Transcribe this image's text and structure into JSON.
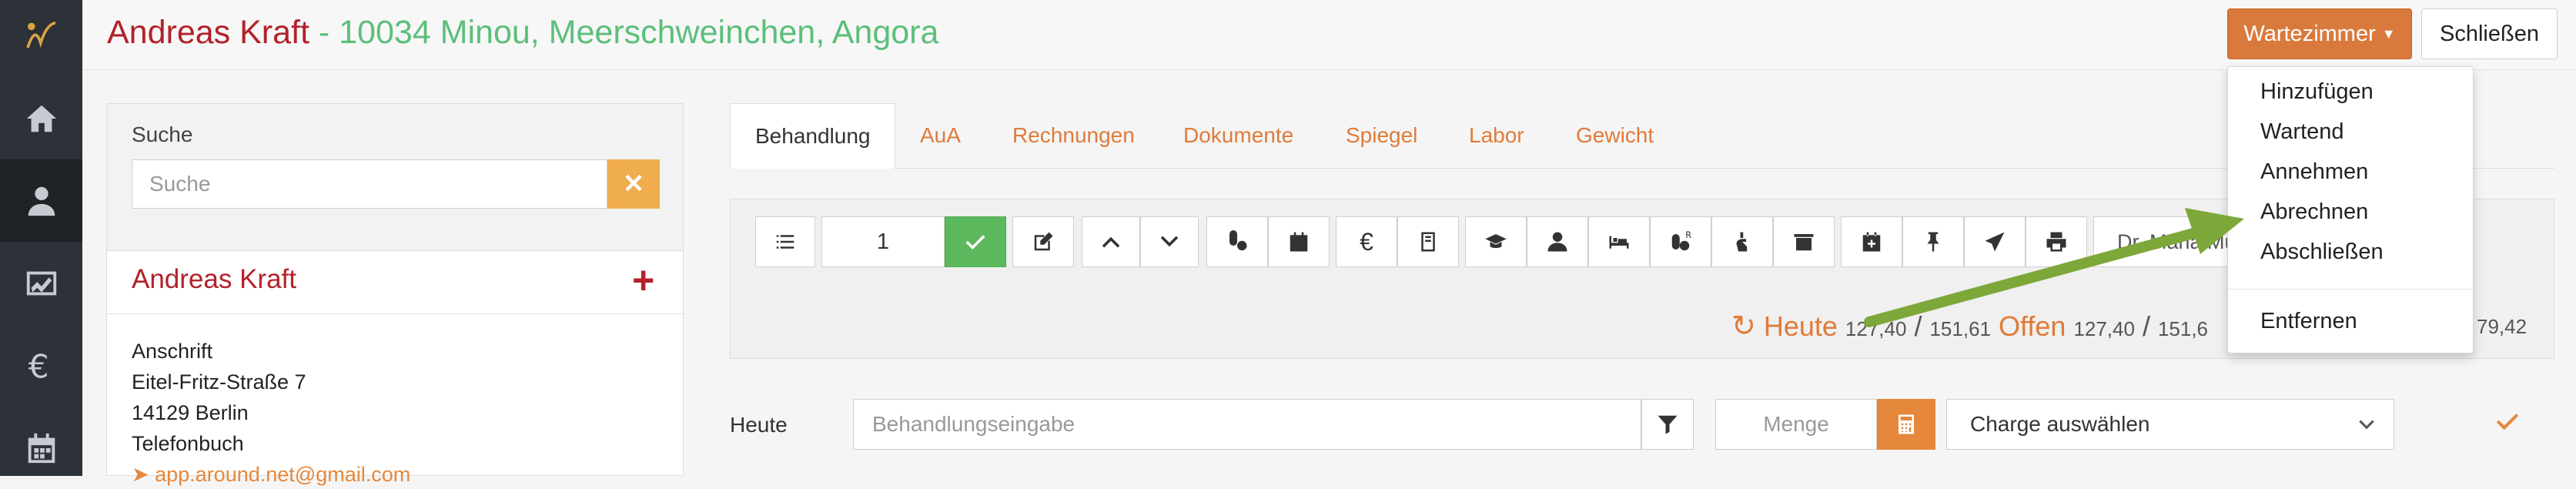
{
  "header": {
    "patient_name": "Andreas Kraft",
    "patient_details": " - 10034 Minou, Meerschweinchen, Angora"
  },
  "buttons": {
    "wartezimmer": "Wartezimmer",
    "schliessen": "Schließen"
  },
  "dropdown": {
    "items": [
      "Hinzufügen",
      "Wartend",
      "Annehmen",
      "Abrechnen",
      "Abschließen",
      "Entfernen"
    ]
  },
  "search": {
    "label": "Suche",
    "placeholder": "Suche"
  },
  "patient": {
    "name": "Andreas Kraft",
    "address_label": "Anschrift",
    "street": "Eitel-Fritz-Straße 7",
    "city": "14129  Berlin",
    "phone_label": "Telefonbuch",
    "email": "app.around.net@gmail.com"
  },
  "tabs": [
    "Behandlung",
    "AuA",
    "Rechnungen",
    "Dokumente",
    "Spiegel",
    "Labor",
    "Gewicht"
  ],
  "toolbar": {
    "quantity_value": "1",
    "doctor": "Dr. Maria Müll"
  },
  "summary": {
    "today_label": "Heute",
    "today_value": "127,40",
    "today_total": "151,61",
    "open_label": "Offen",
    "open_value": "127,40",
    "open_total": "151,6",
    "right_value": "79,42"
  },
  "entry": {
    "label": "Heute",
    "treatment_placeholder": "Behandlungseingabe",
    "quantity_placeholder": "Menge",
    "charge_placeholder": "Charge auswählen"
  },
  "colors": {
    "accent_orange": "#e07b39",
    "button_orange": "#d97a3c",
    "brand_red": "#b3212a",
    "patient_green": "#5bbf7a",
    "success_green": "#5cb85c",
    "arrow_green": "#7ea73a"
  }
}
